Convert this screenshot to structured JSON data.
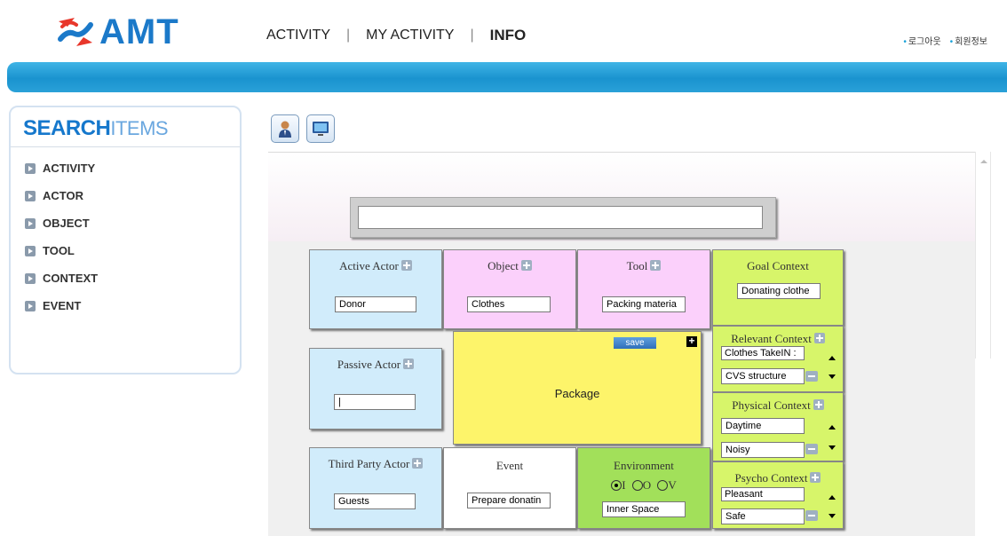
{
  "header": {
    "logo_text": "AMT",
    "nav": [
      "ACTIVITY",
      "MY ACTIVITY",
      "INFO"
    ],
    "nav_sep": "|",
    "top_links": [
      "로그아웃",
      "회원정보"
    ]
  },
  "sidebar": {
    "title_bold": "SEARCH",
    "title_thin": "ITEMS",
    "items": [
      "ACTIVITY",
      "ACTOR",
      "OBJECT",
      "TOOL",
      "CONTEXT",
      "EVENT"
    ]
  },
  "toolbar": {
    "icons": [
      "user-icon",
      "monitor-icon"
    ]
  },
  "editor": {
    "activity_name": "",
    "cells": {
      "active_actor": {
        "title": "Active Actor",
        "value": "Donor"
      },
      "object": {
        "title": "Object",
        "value": "Clothes"
      },
      "tool": {
        "title": "Tool",
        "value": "Packing materia"
      },
      "goal_context": {
        "title": "Goal Context",
        "value": "Donating clothe"
      },
      "passive_actor": {
        "title": "Passive Actor",
        "value": "|"
      },
      "package": {
        "title": "Package",
        "save_label": "save"
      },
      "relevant_context": {
        "title": "Relevant Context",
        "values": [
          "Clothes TakeIN :",
          "CVS structure"
        ]
      },
      "physical_context": {
        "title": "Physical Context",
        "values": [
          "Daytime",
          "Noisy"
        ]
      },
      "third_party_actor": {
        "title": "Third Party Actor",
        "value": "Guests"
      },
      "event": {
        "title": "Event",
        "value": "Prepare donatin"
      },
      "environment": {
        "title": "Environment",
        "options": [
          "I",
          "O",
          "V"
        ],
        "selected": "I",
        "value": "Inner Space"
      },
      "psycho_context": {
        "title": "Psycho Context",
        "values": [
          "Pleasant",
          "Safe"
        ]
      }
    }
  },
  "colors": {
    "brand_blue": "#1b79c9",
    "actor_blue": "#d1ecfb",
    "object_pink": "#fbd0fb",
    "context_green": "#d7f56a",
    "environment_green": "#a2e05a",
    "package_yellow": "#fdf46a"
  }
}
